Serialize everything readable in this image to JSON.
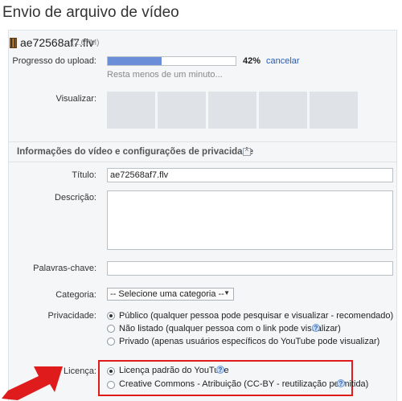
{
  "page": {
    "title": "Envio de arquivo de vídeo"
  },
  "file": {
    "name": "ae72568af7.flv",
    "size": "(2.67M)"
  },
  "upload": {
    "label": "Progresso do upload:",
    "progress": 0.42,
    "percent_text": "42%",
    "cancel_label": "cancelar",
    "remaining_text": "Resta menos de um minuto..."
  },
  "preview": {
    "label": "Visualizar:",
    "thumbnails": 5
  },
  "info": {
    "section_title": "Informações do vídeo e configurações de privacidade",
    "title_label": "Título:",
    "title_value": "ae72568af7.flv",
    "description_label": "Descrição:",
    "description_value": "",
    "tags_label": "Palavras-chave:",
    "tags_value": "",
    "category_label": "Categoria:",
    "category_value": "-- Selecione uma categoria --"
  },
  "privacy": {
    "label": "Privacidade:",
    "options": [
      {
        "label": "Público (qualquer pessoa pode pesquisar e visualizar - recomendado)",
        "checked": true,
        "help": false
      },
      {
        "label": "Não listado (qualquer pessoa com o link pode visualizar)",
        "checked": false,
        "help": true
      },
      {
        "label": "Privado (apenas usuários específicos do YouTube pode visualizar)",
        "checked": false,
        "help": false
      }
    ]
  },
  "license": {
    "label": "Licença:",
    "options": [
      {
        "label": "Licença padrão do YouTube",
        "checked": true,
        "help": true
      },
      {
        "label": "Creative Commons - Atribuição (CC-BY - reutilização permitida)",
        "checked": false,
        "help": true
      }
    ]
  },
  "colors": {
    "accent_link": "#1a5cc4",
    "progress_fill": "#6a8fd8",
    "highlight_box": "#e01b1b",
    "arrow": "#e01b1b",
    "panel_background": "#f4f6f8"
  },
  "icons": {
    "file": "film-file-icon",
    "collapse": "collapse-section-icon",
    "help": "help-question-icon",
    "arrow": "red-arrow-icon"
  }
}
